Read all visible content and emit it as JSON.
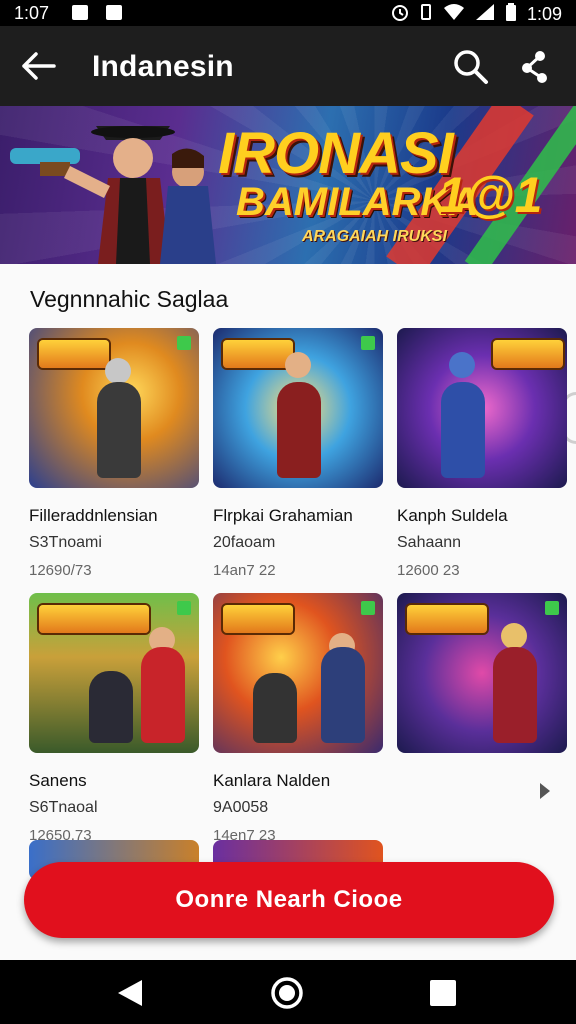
{
  "status_bar": {
    "time_left": "1:07",
    "time_right": "1:09"
  },
  "app_bar": {
    "title": "Indanesin",
    "back_icon": "arrow-left-icon",
    "search_icon": "search-icon",
    "share_icon": "share-icon"
  },
  "banner": {
    "headline": "IRONASI",
    "subline": "BAMILARKA",
    "number": "1@1",
    "tagline": "ARAGAIAH IRUKSI"
  },
  "section": {
    "title": "Vegnnnahic Saglaa"
  },
  "games": [
    {
      "name": "Filleraddnlensian",
      "sub": "S3Tnoami",
      "date": "12690/73"
    },
    {
      "name": "Flrpkai Grahamian",
      "sub": "20faoam",
      "date": "14an7 22"
    },
    {
      "name": "Kanph Suldela",
      "sub": "Sahaann",
      "date": "12600 23"
    },
    {
      "name": "Sanens",
      "sub": "S6Tnaoal",
      "date": "12650,73"
    },
    {
      "name": "Kanlara Nalden",
      "sub": "9A0058",
      "date": "14en7 23"
    }
  ],
  "cta": {
    "label": "Oonre Nearh Ciooe"
  },
  "colors": {
    "app_bar": "#1e1e1e",
    "cta": "#e1101d",
    "status_bar": "#000000"
  }
}
